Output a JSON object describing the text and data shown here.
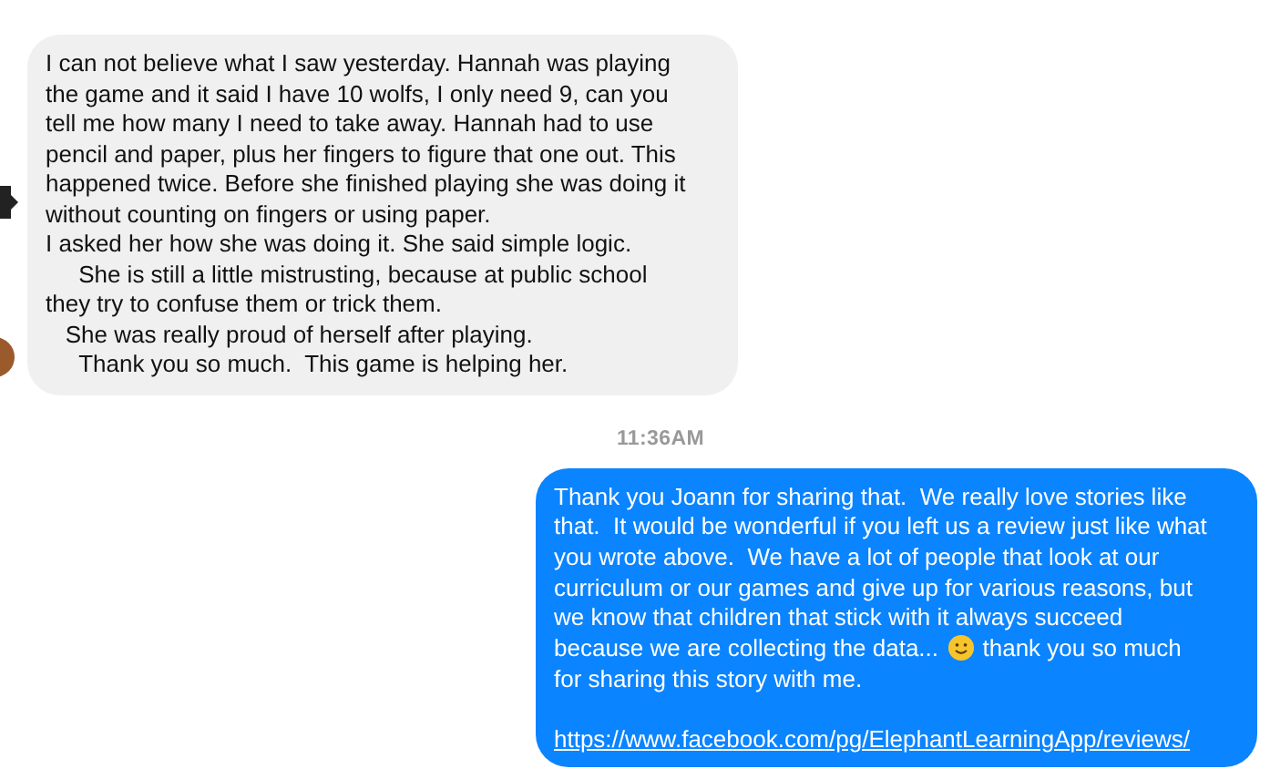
{
  "messages": [
    {
      "kind": "incoming",
      "text": "I can not believe what I saw yesterday. Hannah was playing the game and it said I have 10 wolfs, I only need 9, can you tell me how many I need to take away. Hannah had to use pencil and paper, plus her fingers to figure that one out. This happened twice. Before she finished playing she was doing it without counting on fingers or using paper.\nI asked her how she was doing it. She said simple logic.\n     She is still a little mistrusting, because at public school they try to confuse them or trick them.\n   She was really proud of herself after playing.\n     Thank you so much.  This game is helping her."
    },
    {
      "kind": "timestamp",
      "text": "11:36AM"
    },
    {
      "kind": "outgoing",
      "text_before": "Thank you Joann for sharing that.  We really love stories like that.  It would be wonderful if you left us a review just like what you wrote above.  We have a lot of people that look at our curriculum or our games and give up for various reasons, but we know that children that stick with it always succeed because we are collecting the data... ",
      "text_after": " thank you so much for sharing this story with me.",
      "link": "https://www.facebook.com/pg/ElephantLearningApp/reviews/"
    }
  ]
}
